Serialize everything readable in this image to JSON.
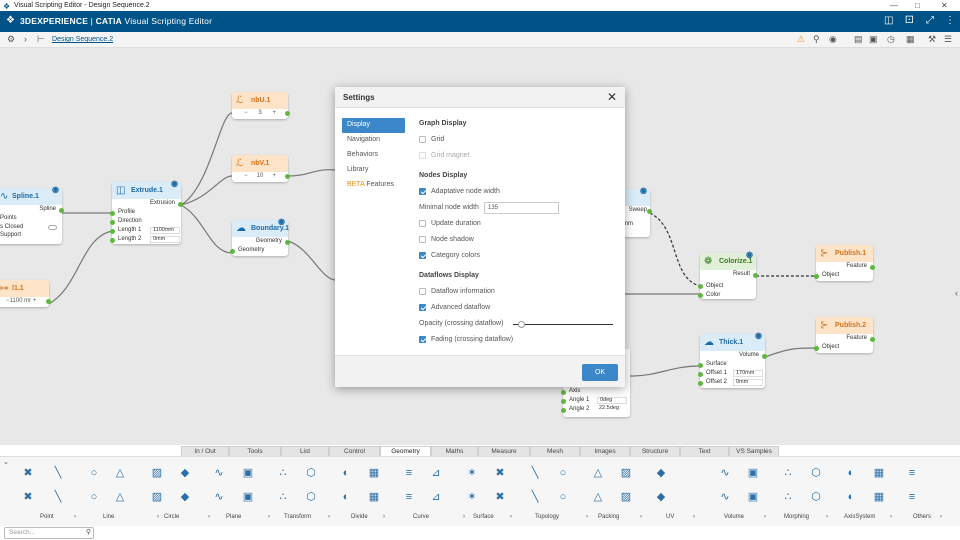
{
  "window": {
    "title": "Visual Scripting Editor - Design Sequence.2"
  },
  "app": {
    "brand_prefix": "3DEXPERIENCE",
    "brand_sep": " | ",
    "brand_product": "CATIA",
    "brand_app": " Visual Scripting Editor"
  },
  "breadcrumb": {
    "link": "Design Sequence.2"
  },
  "nodes": {
    "nbu": {
      "title": "nbU.1",
      "minus": "−",
      "value": "3",
      "plus": "+"
    },
    "nbv": {
      "title": "nbV.1",
      "minus": "−",
      "value": "10",
      "plus": "+"
    },
    "spline": {
      "title": "Spline.1",
      "out": "Spline",
      "r1": "Points",
      "r2": "s Closed",
      "r3": "Support"
    },
    "extrude": {
      "title": "Extrude.1",
      "out": "Extrusion",
      "p1": "Profile",
      "p2": "Direction",
      "p3": "Length 1",
      "p4": "Length 2",
      "v3": "1100mm",
      "v4": "0mm"
    },
    "boundary": {
      "title": "Boundary.1",
      "out": "Geometry",
      "in": "Geometry"
    },
    "l1": {
      "title": "l1.1",
      "value": "−1100 mr",
      "plus": "+"
    },
    "sweep": {
      "out": "Sweep",
      "partial": "mm"
    },
    "colorize": {
      "title": "Colorize.1",
      "out": "Result",
      "in1": "Object",
      "in2": "Color"
    },
    "publish1": {
      "title": "Publish.1",
      "out": "Feature",
      "in": "Object"
    },
    "publish2": {
      "title": "Publish.2",
      "out": "Feature",
      "in": "Object"
    },
    "thick": {
      "title": "Thick.1",
      "out": "Volume",
      "in1": "Surface",
      "in2": "Offset 1",
      "in3": "Offset 2",
      "v2": "170mm",
      "v3": "0mm"
    },
    "revolve": {
      "in1": "Axis",
      "in2": "Angle 1",
      "in3": "Angle 2",
      "v2": "0deg",
      "v3": "22.5deg"
    }
  },
  "settings": {
    "title": "Settings",
    "nav": [
      "Display",
      "Navigation",
      "Behaviors",
      "Library"
    ],
    "beta_prefix": "BETA",
    "beta_suffix": " Features",
    "graph_display": "Graph Display",
    "grid": "Grid",
    "grid_magnet": "Grid magnet",
    "nodes_display": "Nodes Display",
    "adaptive_width": "Adaptative node width",
    "min_width_label": "Minimal node width",
    "min_width_value": "135",
    "update_duration": "Update duration",
    "node_shadow": "Node shadow",
    "category_colors": "Category colors",
    "dataflows_display": "Dataflows Display",
    "dataflow_info": "Dataflow information",
    "advanced_dataflow": "Advanced dataflow",
    "opacity_label": "Opacity (crossing dataflow)",
    "opacity_value": 0.05,
    "fading": "Fading (crossing dataflow)",
    "ok": "OK"
  },
  "tabs": [
    "In / Out",
    "Tools",
    "List",
    "Control",
    "Geometry",
    "Maths",
    "Measure",
    "Mesh",
    "Images",
    "Structure",
    "Text",
    "VS Samples"
  ],
  "active_tab": "Geometry",
  "groups": [
    "Point",
    "Line",
    "Circle",
    "Plane",
    "Transform",
    "Divide",
    "Curve",
    "Surface",
    "Topology",
    "Packing",
    "UV",
    "Volume",
    "Morphing",
    "AxisSystem",
    "Others"
  ],
  "search": {
    "placeholder": "Search..."
  },
  "colors": {
    "accent": "#005386",
    "selection": "#3a87c9",
    "port": "#5eb83f",
    "beta": "#e2901a"
  }
}
